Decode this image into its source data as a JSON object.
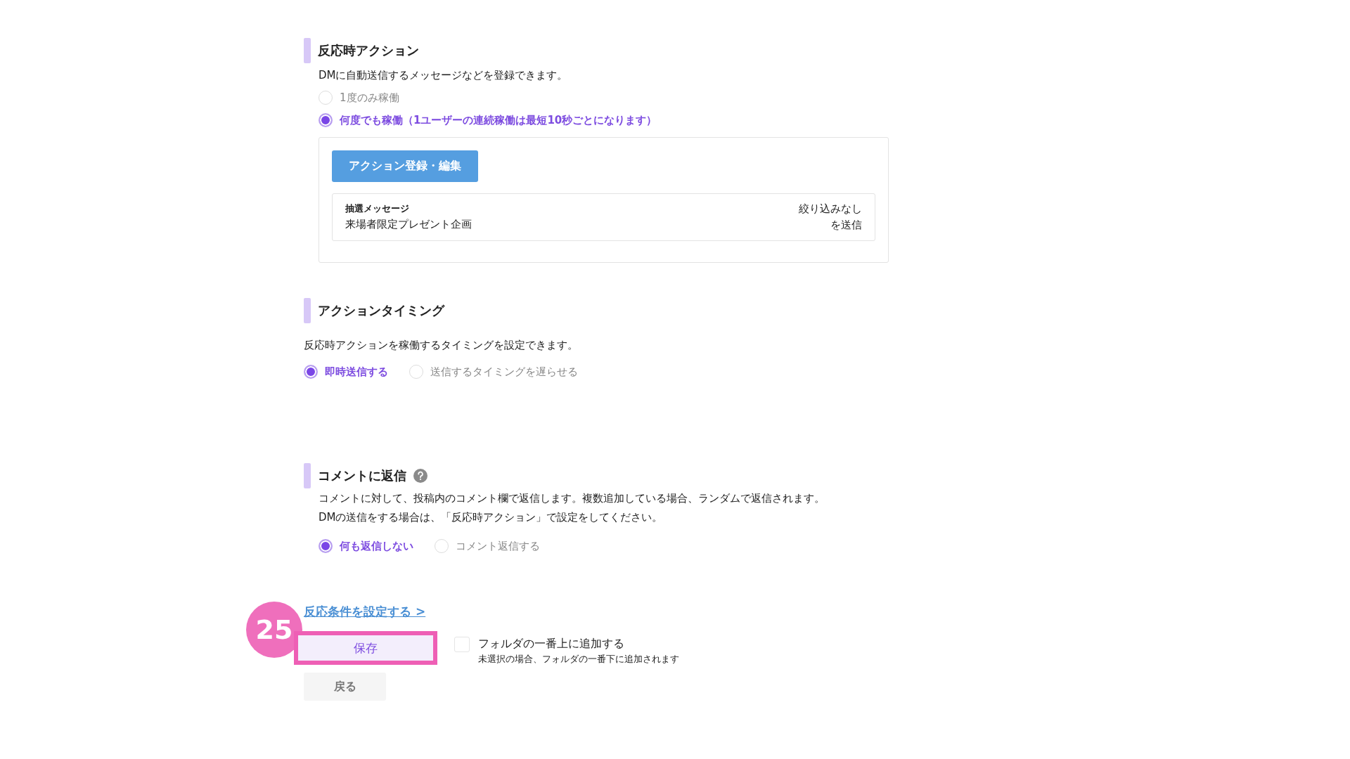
{
  "reaction_action": {
    "title": "反応時アクション",
    "description": "DMに自動送信するメッセージなどを登録できます。",
    "options": [
      {
        "label": "1度のみ稼働",
        "selected": false
      },
      {
        "label": "何度でも稼働（1ユーザーの連続稼働は最短10秒ごとになります）",
        "selected": true
      }
    ],
    "edit_button": "アクション登録・編集",
    "message": {
      "type": "抽選メッセージ",
      "name": "来場者限定プレゼント企画",
      "filter": "絞り込みなし",
      "filter_suffix": "を送信"
    }
  },
  "action_timing": {
    "title": "アクションタイミング",
    "description": "反応時アクションを稼働するタイミングを設定できます。",
    "options": [
      {
        "label": "即時送信する",
        "selected": true
      },
      {
        "label": "送信するタイミングを遅らせる",
        "selected": false
      }
    ]
  },
  "comment_reply": {
    "title": "コメントに返信",
    "description": [
      "コメントに対して、投稿内のコメント欄で返信します。複数追加している場合、ランダムで返信されます。",
      "DMの送信をする場合は、「反応時アクション」で設定をしてください。"
    ],
    "options": [
      {
        "label": "何も返信しない",
        "selected": true
      },
      {
        "label": "コメント返信する",
        "selected": false
      }
    ]
  },
  "condition_link": "反応条件を設定する >",
  "save_button": "保存",
  "callout": "25",
  "folder_top": {
    "label": "フォルダの一番上に追加する",
    "note": "未選択の場合、フォルダの一番下に追加されます",
    "checked": false
  },
  "back_button": "戻る"
}
